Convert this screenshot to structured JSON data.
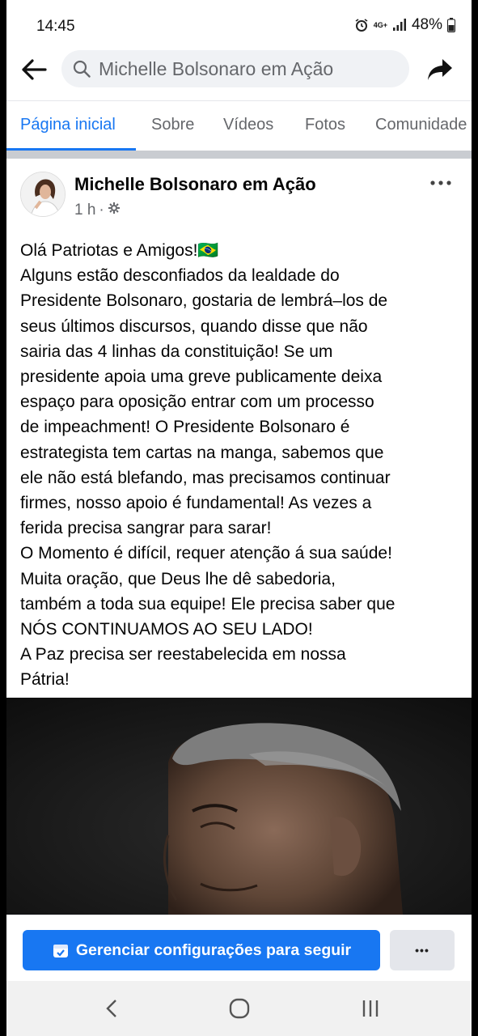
{
  "status_bar": {
    "time": "14:45",
    "network": "4G+",
    "battery": "48%",
    "icons": [
      "alarm-icon",
      "network-icon",
      "signal-icon",
      "battery-icon"
    ]
  },
  "header": {
    "search_text": "Michelle Bolsonaro em Ação",
    "icons": [
      "back-arrow-icon",
      "search-icon",
      "share-icon"
    ]
  },
  "tabs": [
    {
      "label": "Página inicial",
      "active": true
    },
    {
      "label": "Sobre",
      "active": false
    },
    {
      "label": "Vídeos",
      "active": false
    },
    {
      "label": "Fotos",
      "active": false
    },
    {
      "label": "Comunidade",
      "active": false
    }
  ],
  "post": {
    "author": "Michelle Bolsonaro em Ação",
    "time": "1 h",
    "separator": "·",
    "privacy_icon": "gear-icon",
    "lines": [
      "Olá Patriotas e Amigos!🇧🇷",
      "Alguns  estão desconfiados da lealdade do",
      "Presidente Bolsonaro, gostaria de lembrá–los de",
      "seus  últimos discursos, quando disse que  não",
      "sairia das 4 linhas da constituição! Se um",
      "presidente apoia uma greve publicamente deixa",
      "espaço para oposição entrar com  um processo",
      "de impeachment! O Presidente Bolsonaro é",
      "estrategista tem cartas na manga, sabemos que",
      "ele não está blefando, mas precisamos continuar",
      "firmes, nosso apoio é fundamental! As vezes a",
      "ferida precisa sangrar para sarar!",
      "O Momento é difícil, requer atenção á sua saúde!",
      "Muita oração, que Deus lhe dê sabedoria,",
      "também a toda sua equipe! Ele precisa saber que",
      "NÓS CONTINUAMOS AO SEU LADO!",
      "A Paz precisa ser reestabelecida em nossa",
      "Pátria!"
    ]
  },
  "bottom": {
    "manage_label": "Gerenciar configurações para seguir",
    "more_label": "•••"
  },
  "colors": {
    "accent": "#1877f2",
    "text": "#050505",
    "secondary_text": "#65676b",
    "search_bg": "#f0f2f5"
  }
}
